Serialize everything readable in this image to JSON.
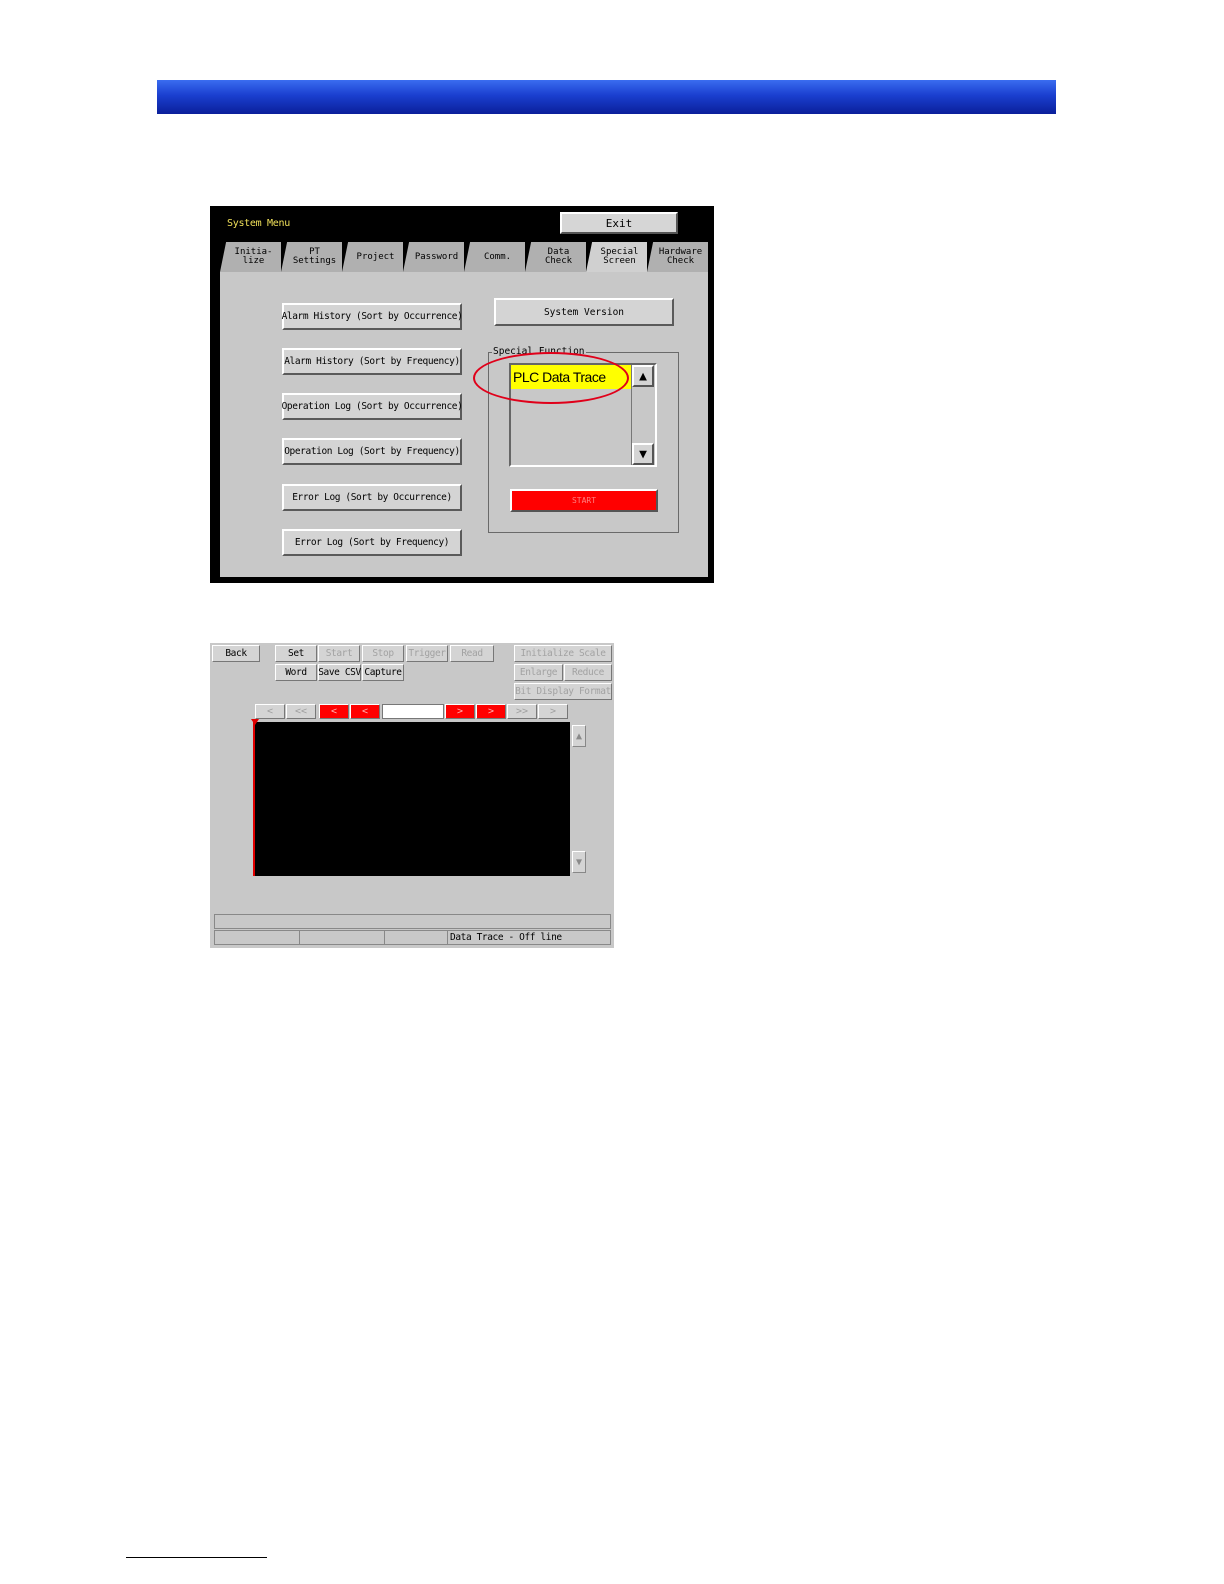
{
  "colors": {
    "header_bar": "#1a3fcf",
    "highlight": "#e0001a",
    "selected_item": "#ffff00",
    "start_button": "#ff0000"
  },
  "system_menu": {
    "title": "System Menu",
    "exit_label": "Exit",
    "tabs": [
      {
        "label": "Initia-\nlize",
        "active": false
      },
      {
        "label": "PT\nSettings",
        "active": false
      },
      {
        "label": "Project",
        "active": false
      },
      {
        "label": "Password",
        "active": false
      },
      {
        "label": "Comm.",
        "active": false
      },
      {
        "label": "Data\nCheck",
        "active": false
      },
      {
        "label": "Special\nScreen",
        "active": true
      },
      {
        "label": "Hardware\nCheck",
        "active": false
      }
    ],
    "left_buttons": [
      "Alarm History (Sort by Occurrence)",
      "Alarm History (Sort by Frequency)",
      "Operation Log (Sort by Occurrence)",
      "Operation Log (Sort by Frequency)",
      "Error Log (Sort by Occurrence)",
      "Error Log (Sort by Frequency)"
    ],
    "system_version_label": "System Version",
    "special_function_label": "Special Function",
    "special_function_items": [
      "PLC Data Trace"
    ],
    "start_label": "START"
  },
  "data_trace": {
    "back_label": "Back",
    "row1": [
      "Set",
      "Start",
      "Stop",
      "Trigger",
      "Read"
    ],
    "row2": [
      "Word",
      "Save CSV",
      "Capture"
    ],
    "initialize_scale_label": "Initialize Scale",
    "enlarge_label": "Enlarge",
    "reduce_label": "Reduce",
    "bit_display_format_label": "Bit Display Format",
    "nav_buttons": [
      "<",
      "<<",
      "<",
      "<",
      ">",
      ">",
      ">>",
      ">"
    ],
    "status_text": "Data Trace - Off line"
  }
}
